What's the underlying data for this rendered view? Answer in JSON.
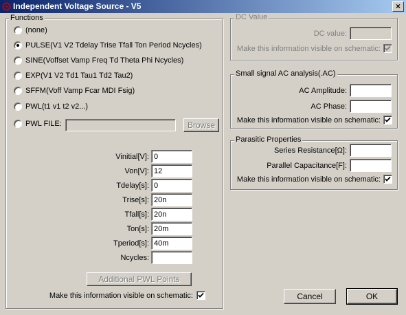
{
  "window": {
    "title": "Independent Voltage Source - V5",
    "icon": "app-icon"
  },
  "functions": {
    "legend": "Functions",
    "options": [
      {
        "label": "(none)",
        "selected": false
      },
      {
        "label": "PULSE(V1 V2 Tdelay Trise Tfall Ton Period Ncycles)",
        "selected": true
      },
      {
        "label": "SINE(Voffset Vamp Freq Td Theta Phi Ncycles)",
        "selected": false
      },
      {
        "label": "EXP(V1 V2 Td1 Tau1 Td2 Tau2)",
        "selected": false
      },
      {
        "label": "SFFM(Voff Vamp Fcar MDI Fsig)",
        "selected": false
      },
      {
        "label": "PWL(t1 v1 t2 v2...)",
        "selected": false
      },
      {
        "label": "PWL FILE:",
        "selected": false
      }
    ],
    "pwl_file_value": "",
    "browse_label": "Browse",
    "params": [
      {
        "label": "Vinitial[V]:",
        "value": "0"
      },
      {
        "label": "Von[V]:",
        "value": "12"
      },
      {
        "label": "Tdelay[s]:",
        "value": "0"
      },
      {
        "label": "Trise[s]:",
        "value": "20n"
      },
      {
        "label": "Tfall[s]:",
        "value": "20n"
      },
      {
        "label": "Ton[s]:",
        "value": "20m"
      },
      {
        "label": "Tperiod[s]:",
        "value": "40m"
      },
      {
        "label": "Ncycles:",
        "value": ""
      }
    ],
    "additional_pwl_label": "Additional PWL Points",
    "visible_label": "Make this information visible on schematic:",
    "visible_checked": true
  },
  "dc_value": {
    "legend": "DC Value",
    "label": "DC value:",
    "value": "",
    "visible_label": "Make this information visible on schematic:",
    "visible_checked": true
  },
  "ac_analysis": {
    "legend": "Small signal AC analysis(.AC)",
    "amplitude_label": "AC Amplitude:",
    "amplitude_value": "",
    "phase_label": "AC Phase:",
    "phase_value": "",
    "visible_label": "Make this information visible on schematic:",
    "visible_checked": true
  },
  "parasitic": {
    "legend": "Parasitic Properties",
    "resistance_label": "Series Resistance[Ω]:",
    "resistance_value": "",
    "capacitance_label": "Parallel Capacitance[F]:",
    "capacitance_value": "",
    "visible_label": "Make this information visible on schematic:",
    "visible_checked": true
  },
  "buttons": {
    "cancel": "Cancel",
    "ok": "OK"
  },
  "colors": {
    "titlebar_start": "#0a246a",
    "titlebar_end": "#a6caf0",
    "face": "#d4d0c8"
  }
}
